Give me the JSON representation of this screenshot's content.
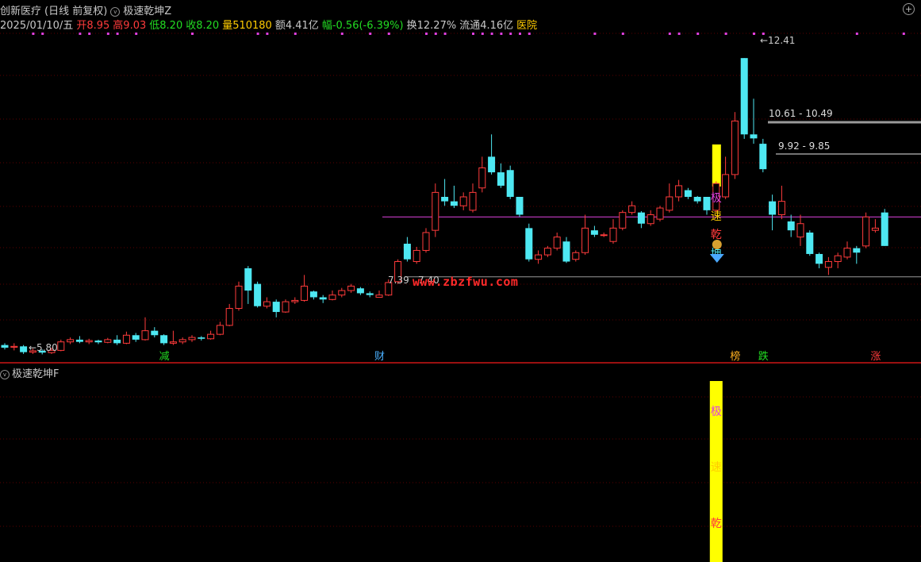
{
  "header": {
    "title": "创新医疗",
    "period": "(日线 前复权)",
    "indicator_name": "极速乾坤Z",
    "date": "2025/01/10/五",
    "open_label": "开",
    "open": "8.95",
    "high_label": "高",
    "high": "9.03",
    "low_label": "低",
    "low": "8.20",
    "close_label": "收",
    "close": "8.20",
    "volume_label": "量",
    "volume": "510180",
    "amount_label": "额",
    "amount": "4.41亿",
    "change_label": "幅",
    "change": "-0.56(-6.39%)",
    "turnover_label": "换",
    "turnover": "12.27%",
    "float_label": "流通",
    "float_cap": "4.16亿",
    "sector": "医院"
  },
  "sub_panel": {
    "title": "极速乾坤F"
  },
  "watermark": "www.zbzfwu.com",
  "colors": {
    "up": "#ff3b3b",
    "down": "#4ee8f2",
    "purple_line": "#c83cc8",
    "yellow_bar": "#ffff00",
    "gray_line": "#9a9a9a",
    "grid": "#5a0000",
    "divider": "#9a1010"
  },
  "chart_data": {
    "type": "candlestick",
    "y_range": [
      5.6,
      13.0
    ],
    "candles": [
      [
        5.98,
        5.92,
        6.02,
        5.88
      ],
      [
        5.93,
        5.95,
        6.02,
        5.86
      ],
      [
        5.95,
        5.82,
        5.98,
        5.78
      ],
      [
        5.82,
        5.85,
        5.9,
        5.78
      ],
      [
        5.85,
        5.81,
        5.88,
        5.77
      ],
      [
        5.81,
        5.86,
        5.92,
        5.78
      ],
      [
        5.86,
        6.05,
        6.1,
        5.84
      ],
      [
        6.05,
        6.1,
        6.15,
        6.0
      ],
      [
        6.1,
        6.05,
        6.18,
        6.02
      ],
      [
        6.05,
        6.08,
        6.12,
        6.0
      ],
      [
        6.08,
        6.04,
        6.1,
        6.0
      ],
      [
        6.04,
        6.1,
        6.14,
        6.02
      ],
      [
        6.1,
        6.02,
        6.2,
        5.98
      ],
      [
        6.02,
        6.2,
        6.28,
        6.0
      ],
      [
        6.2,
        6.1,
        6.25,
        6.05
      ],
      [
        6.1,
        6.3,
        6.6,
        6.08
      ],
      [
        6.3,
        6.2,
        6.38,
        6.15
      ],
      [
        6.2,
        6.02,
        6.22,
        5.98
      ],
      [
        6.02,
        6.05,
        6.3,
        5.98
      ],
      [
        6.05,
        6.1,
        6.15,
        6.0
      ],
      [
        6.1,
        6.15,
        6.2,
        6.05
      ],
      [
        6.15,
        6.12,
        6.18,
        6.08
      ],
      [
        6.12,
        6.22,
        6.3,
        6.1
      ],
      [
        6.22,
        6.42,
        6.5,
        6.2
      ],
      [
        6.42,
        6.8,
        6.9,
        6.4
      ],
      [
        6.8,
        7.3,
        7.4,
        6.75
      ],
      [
        7.7,
        7.2,
        7.75,
        6.9
      ],
      [
        7.35,
        6.85,
        7.4,
        6.82
      ],
      [
        6.85,
        6.95,
        7.05,
        6.8
      ],
      [
        6.95,
        6.72,
        7.0,
        6.6
      ],
      [
        6.72,
        6.95,
        7.0,
        6.7
      ],
      [
        6.95,
        6.98,
        7.05,
        6.9
      ],
      [
        6.98,
        7.3,
        7.55,
        6.95
      ],
      [
        7.18,
        7.05,
        7.2,
        7.0
      ],
      [
        7.05,
        7.0,
        7.1,
        6.92
      ],
      [
        7.0,
        7.1,
        7.2,
        6.98
      ],
      [
        7.1,
        7.2,
        7.26,
        7.05
      ],
      [
        7.2,
        7.3,
        7.35,
        7.15
      ],
      [
        7.25,
        7.14,
        7.28,
        7.1
      ],
      [
        7.14,
        7.1,
        7.18,
        7.05
      ],
      [
        7.05,
        7.1,
        7.2,
        7.05
      ],
      [
        7.1,
        7.38,
        7.45,
        7.08
      ],
      [
        7.4,
        7.85,
        7.9,
        7.35
      ],
      [
        8.25,
        7.9,
        8.4,
        7.85
      ],
      [
        7.85,
        8.1,
        8.18,
        7.8
      ],
      [
        8.1,
        8.5,
        8.6,
        8.05
      ],
      [
        8.55,
        9.4,
        9.6,
        8.4
      ],
      [
        9.3,
        9.2,
        9.7,
        9.1
      ],
      [
        9.2,
        9.1,
        9.55,
        9.05
      ],
      [
        9.1,
        9.3,
        9.4,
        9.0
      ],
      [
        9.0,
        9.4,
        9.6,
        8.95
      ],
      [
        9.5,
        9.95,
        10.2,
        9.4
      ],
      [
        10.2,
        9.85,
        10.7,
        9.8
      ],
      [
        9.85,
        9.55,
        10.05,
        9.5
      ],
      [
        9.9,
        9.3,
        10.0,
        9.25
      ],
      [
        9.3,
        8.9,
        9.3,
        8.85
      ],
      [
        8.6,
        7.9,
        8.7,
        7.85
      ],
      [
        7.9,
        8.0,
        8.1,
        7.8
      ],
      [
        8.0,
        8.15,
        8.2,
        7.95
      ],
      [
        8.15,
        8.4,
        8.5,
        8.1
      ],
      [
        8.3,
        7.85,
        8.4,
        7.82
      ],
      [
        7.9,
        8.05,
        8.1,
        7.85
      ],
      [
        8.05,
        8.6,
        8.9,
        8.0
      ],
      [
        8.55,
        8.45,
        8.65,
        8.4
      ],
      [
        8.45,
        8.45,
        8.5,
        8.4
      ],
      [
        8.3,
        8.6,
        8.8,
        8.25
      ],
      [
        8.6,
        8.95,
        9.0,
        8.55
      ],
      [
        8.95,
        9.1,
        9.2,
        8.9
      ],
      [
        8.95,
        8.7,
        8.98,
        8.6
      ],
      [
        8.7,
        8.9,
        9.0,
        8.65
      ],
      [
        8.8,
        9.05,
        9.1,
        8.75
      ],
      [
        9.0,
        9.3,
        9.6,
        8.95
      ],
      [
        9.3,
        9.55,
        9.68,
        9.2
      ],
      [
        9.45,
        9.3,
        9.5,
        9.25
      ],
      [
        9.3,
        9.2,
        9.32,
        9.15
      ],
      [
        9.3,
        9.0,
        9.3,
        8.9
      ],
      [
        9.0,
        9.6,
        9.65,
        8.95
      ],
      [
        9.3,
        9.8,
        10.2,
        9.25
      ],
      [
        9.8,
        11.0,
        11.2,
        9.7
      ],
      [
        12.41,
        10.7,
        12.41,
        10.6
      ],
      [
        10.7,
        10.61,
        11.5,
        10.49
      ],
      [
        10.49,
        9.92,
        10.6,
        9.85
      ],
      [
        9.2,
        8.9,
        9.35,
        8.55
      ],
      [
        8.9,
        9.2,
        9.55,
        8.8
      ],
      [
        8.75,
        8.55,
        8.9,
        8.4
      ],
      [
        8.4,
        8.7,
        8.9,
        8.2
      ],
      [
        8.5,
        8.02,
        8.55,
        7.98
      ],
      [
        8.02,
        7.8,
        8.05,
        7.7
      ],
      [
        7.72,
        7.85,
        7.95,
        7.55
      ],
      [
        7.85,
        7.98,
        8.05,
        7.7
      ],
      [
        7.95,
        8.15,
        8.3,
        7.9
      ],
      [
        8.15,
        8.05,
        8.2,
        7.8
      ],
      [
        8.2,
        8.85,
        8.95,
        8.15
      ],
      [
        8.55,
        8.6,
        8.8,
        8.5
      ],
      [
        8.95,
        8.2,
        9.03,
        8.2
      ]
    ],
    "annotations": {
      "high": "12.41",
      "low": "5.80",
      "gap_high": "10.61 - 10.49",
      "gap_mid": "9.92 - 9.85",
      "support_a": "7.39",
      "support_b": "7.40"
    },
    "levels": {
      "purple": 8.85,
      "gray_support": 7.4,
      "gray_gap_high": 10.55,
      "gray_gap_mid": 9.88
    },
    "signal_text": [
      "极",
      "速",
      "乾",
      "坤"
    ],
    "bottom_signals": [
      {
        "label": "减",
        "index": 17,
        "color": "#22dd22"
      },
      {
        "label": "财",
        "index": 40,
        "color": "#4ab0ff"
      },
      {
        "label": "榜",
        "index": 78,
        "color": "#ffb020"
      },
      {
        "label": "跌",
        "index": 81,
        "color": "#22dd22"
      },
      {
        "label": "涨",
        "index": 93,
        "color": "#ff3b3b"
      }
    ],
    "signal_index": 76,
    "sub_bar_index": 76,
    "sub_bar_text": [
      "极",
      "速",
      "乾"
    ]
  }
}
